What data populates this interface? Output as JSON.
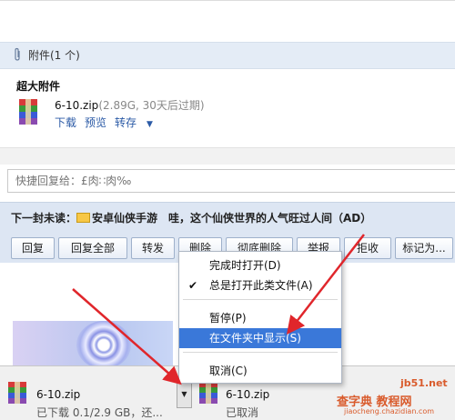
{
  "attachments": {
    "header": "附件(1 个)",
    "big_label": "超大附件",
    "file_name": "6-10.zip",
    "file_meta": "(2.89G, 30天后过期)",
    "actions": [
      "下载",
      "预览",
      "转存"
    ]
  },
  "quick_reply": {
    "placeholder": "快捷回复给：£肉∷肉‰"
  },
  "next_mail": {
    "label": "下一封未读：",
    "subject": "安卓仙侠手游　哇，这个仙侠世界的人气旺过人间（AD）"
  },
  "toolbar": {
    "reply": "回复",
    "reply_all": "回复全部",
    "forward": "转发",
    "delete": "删除",
    "delete_permanently": "彻底删除",
    "report": "举报",
    "reject": "拒收",
    "mark_as": "标记为..."
  },
  "context_menu": {
    "items": [
      {
        "label": "完成时打开(D)",
        "checked": false,
        "highlighted": false
      },
      {
        "label": "总是打开此类文件(A)",
        "checked": true,
        "highlighted": false
      },
      {
        "label": "暂停(P)",
        "checked": false,
        "highlighted": false
      },
      {
        "label": "在文件夹中显示(S)",
        "checked": false,
        "highlighted": true
      },
      {
        "label": "取消(C)",
        "checked": false,
        "highlighted": false
      }
    ]
  },
  "downloads": [
    {
      "name": "6-10.zip",
      "status": "已下载 0.1/2.9 GB，还..."
    },
    {
      "name": "6-10.zip",
      "status": "已取消"
    }
  ],
  "watermark": {
    "line1": "jb51.net",
    "line2": "查字典 教程网",
    "line3": "jiaocheng.chazidian.com"
  },
  "colors": {
    "accent": "#3a78d9",
    "link": "#2b5aa6",
    "panel": "#dde6f3",
    "arrow": "#e0262b"
  }
}
